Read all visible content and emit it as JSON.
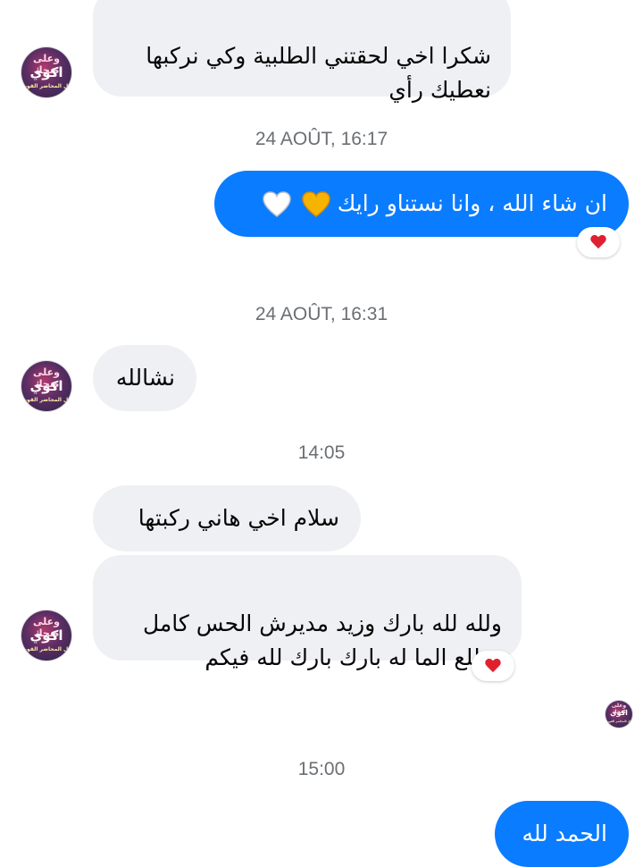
{
  "messages": {
    "m1": "شكرا اخي لحقتني الطلبية وكي نركبها\nنعطيك رأي",
    "m2": "ان شاء الله ، وانا نستناو رايك",
    "m3": "نشالله",
    "m4": "سلام اخي هاني ركبتها",
    "m5": "ولله لله بارك وزيد مديرش الحس كامل\nوطلع الما له بارك بارك لله فيكم",
    "m6": "الحمد لله"
  },
  "timestamps": {
    "t1": "24 AOÛT, 16:17",
    "t2": "24 AOÛT, 16:31",
    "t3": "14:05",
    "t4": "15:00"
  },
  "avatar": {
    "line1": "وعلى ضحك",
    "line2": "اكوي",
    "line3": "كل المحاضر القويه"
  },
  "icons": {
    "reaction": "red-heart-icon",
    "emoji1": "yellow-heart-emoji",
    "emoji2": "white-heart-emoji"
  },
  "colors": {
    "outgoing_bubble": "#0a7cff",
    "incoming_bubble": "#eef0f3",
    "timestamp": "#6b6f74",
    "heart": "#e0202e"
  }
}
